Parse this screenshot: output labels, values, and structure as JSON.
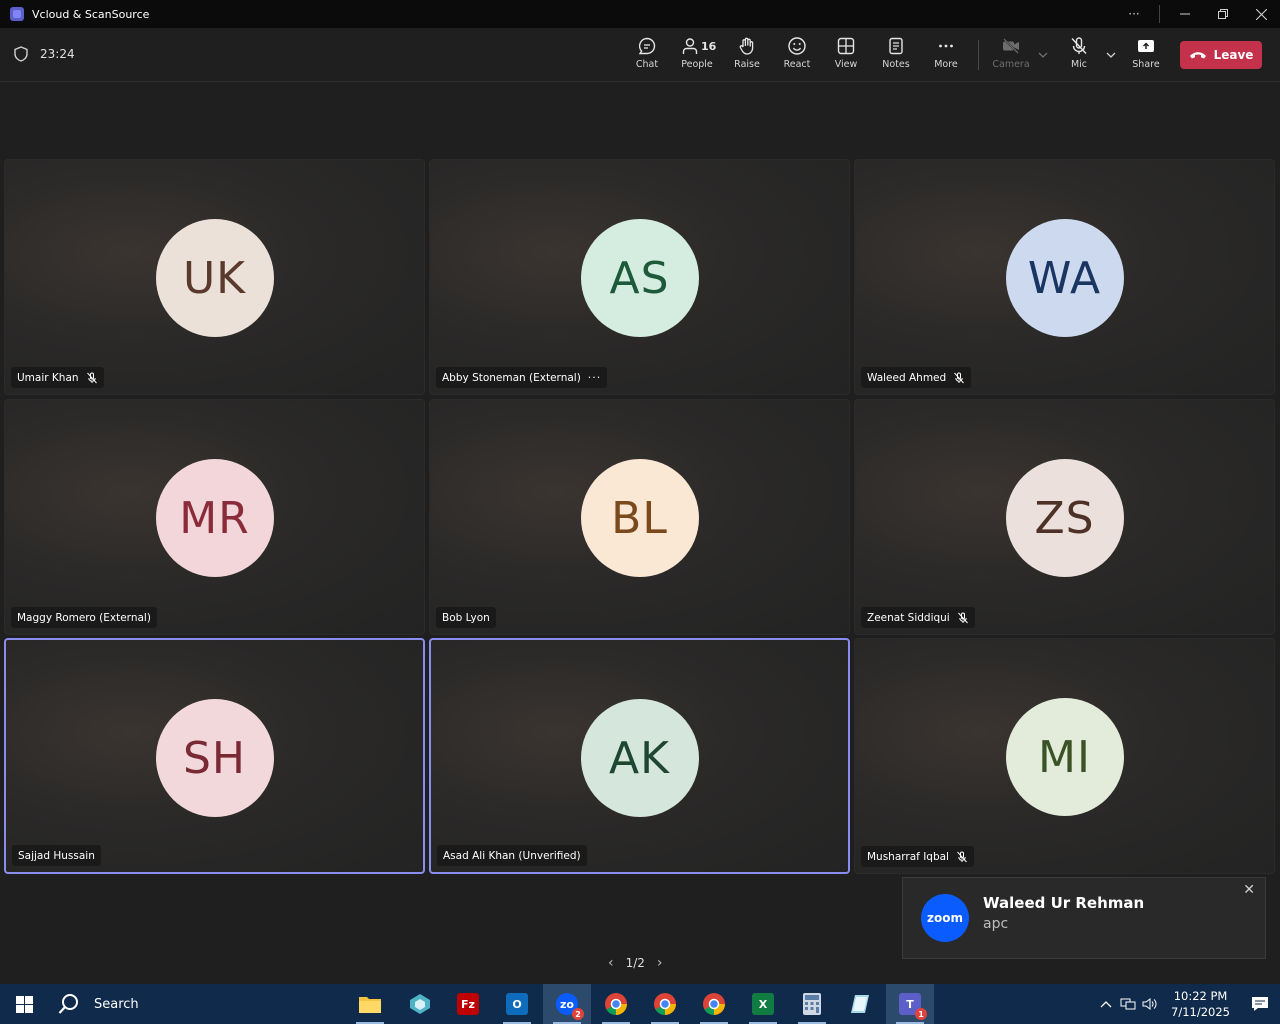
{
  "window": {
    "title": "Vcloud & ScanSource"
  },
  "toolbar": {
    "timer": "23:24",
    "buttons": {
      "chat": "Chat",
      "people": "People",
      "people_count": "16",
      "raise": "Raise",
      "react": "React",
      "view": "View",
      "notes": "Notes",
      "more": "More",
      "camera": "Camera",
      "mic": "Mic",
      "share": "Share"
    },
    "leave": "Leave"
  },
  "participants": [
    {
      "initials": "UK",
      "name": "Umair Khan",
      "muted": true,
      "avatar_bg": "#ece1d9",
      "avatar_fg": "#5a3a2c"
    },
    {
      "initials": "AS",
      "name": "Abby Stoneman (External)",
      "muted": false,
      "more": true,
      "avatar_bg": "#d5ede0",
      "avatar_fg": "#1c5a3a"
    },
    {
      "initials": "WA",
      "name": "Waleed Ahmed",
      "muted": true,
      "avatar_bg": "#ccd9ee",
      "avatar_fg": "#1b3563"
    },
    {
      "initials": "MR",
      "name": "Maggy Romero (External)",
      "muted": false,
      "avatar_bg": "#f2d6da",
      "avatar_fg": "#8a2b3a"
    },
    {
      "initials": "BL",
      "name": "Bob Lyon",
      "muted": false,
      "avatar_bg": "#fbe8d4",
      "avatar_fg": "#7a4a1c"
    },
    {
      "initials": "ZS",
      "name": "Zeenat Siddiqui",
      "muted": true,
      "avatar_bg": "#ebe0dc",
      "avatar_fg": "#4e3227"
    },
    {
      "initials": "SH",
      "name": "Sajjad Hussain",
      "muted": false,
      "active": true,
      "avatar_bg": "#f2d8da",
      "avatar_fg": "#7a2a35"
    },
    {
      "initials": "AK",
      "name": "Asad Ali Khan (Unverified)",
      "muted": false,
      "active": true,
      "avatar_bg": "#d5e6dc",
      "avatar_fg": "#1f4630"
    },
    {
      "initials": "MI",
      "name": "Musharraf Iqbal",
      "muted": true,
      "avatar_bg": "#e3ebdb",
      "avatar_fg": "#3a5226"
    }
  ],
  "pager": {
    "label": "1/2"
  },
  "toast": {
    "logo": "zoom",
    "name": "Waleed Ur Rehman",
    "subtitle": "apc"
  },
  "taskbar": {
    "search": "Search",
    "time": "10:22 PM",
    "date": "7/11/2025",
    "zoom_badge": "2",
    "teams_badge": "1"
  }
}
